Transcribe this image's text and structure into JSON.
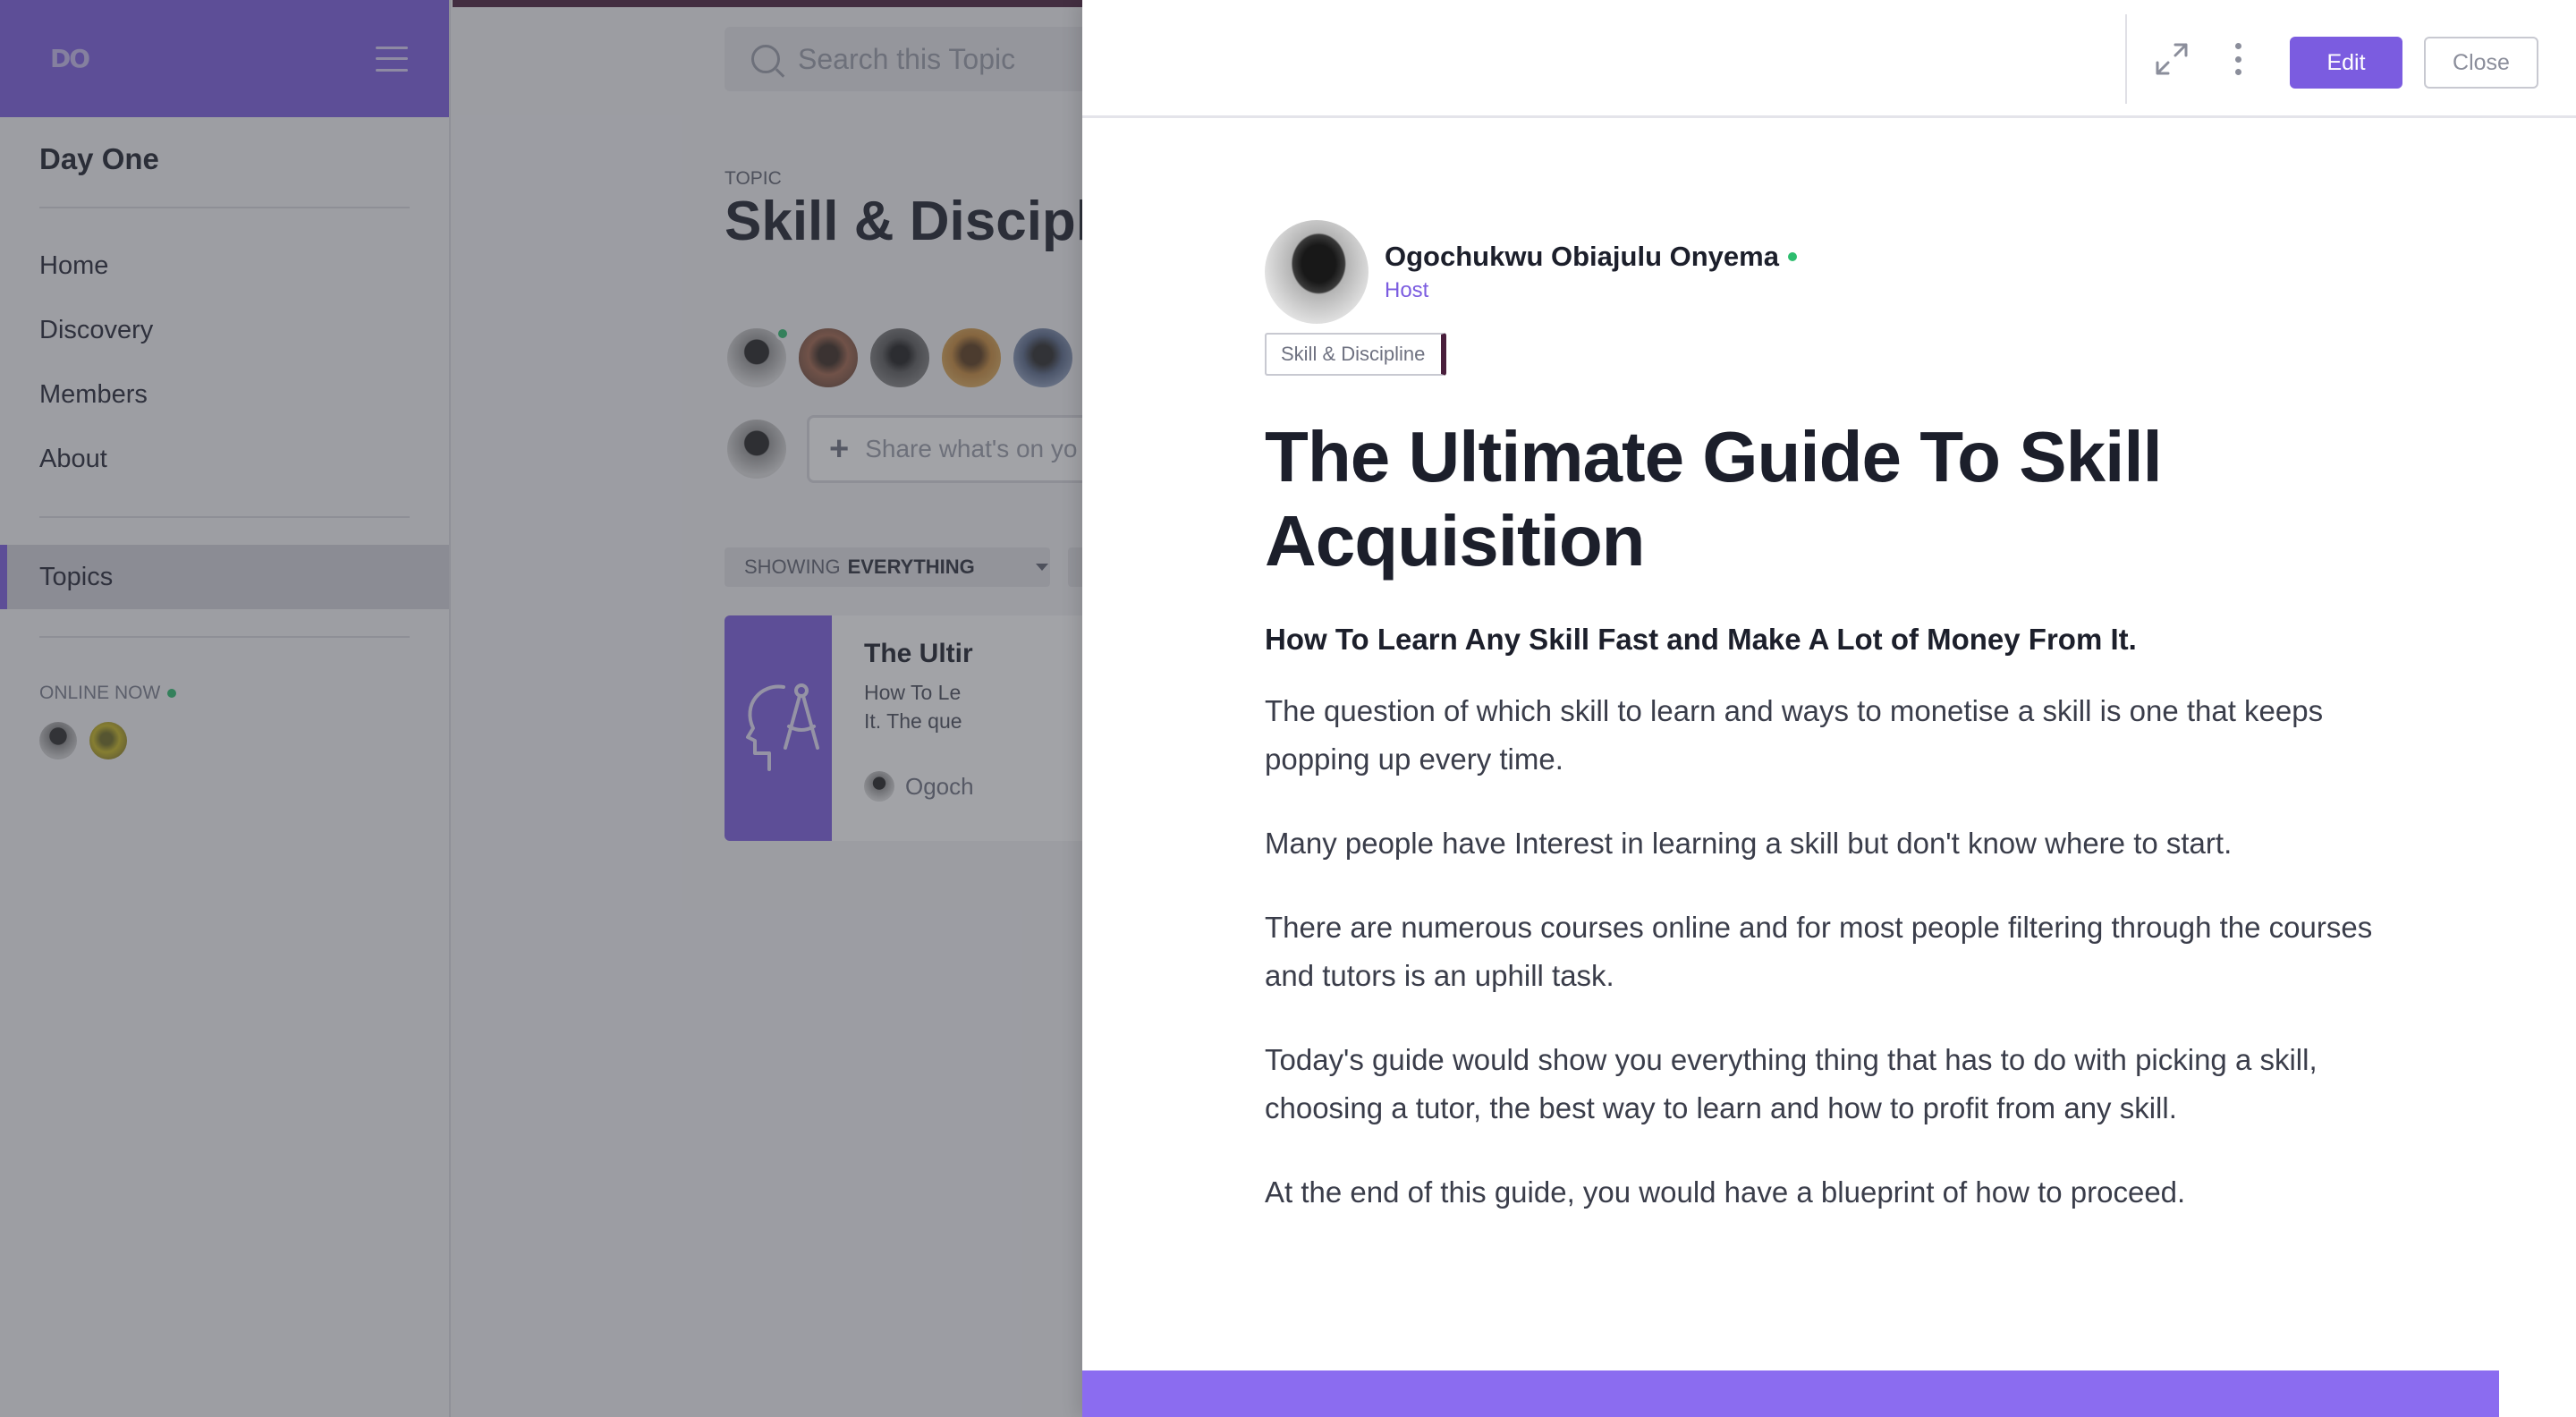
{
  "sidebar": {
    "logo": "DO",
    "space_name": "Day One",
    "nav": [
      "Home",
      "Discovery",
      "Members",
      "About"
    ],
    "topics_label": "Topics",
    "online_label": "ONLINE NOW"
  },
  "main": {
    "search_placeholder": "Search this Topic",
    "topic_label": "TOPIC",
    "topic_title": "Skill & Disciplin",
    "share_placeholder": "Share what's on yo",
    "filter_prefix": "SHOWING",
    "filter_value": "EVERYTHING",
    "post": {
      "title": "The Ultir",
      "excerpt_1": "How To Le",
      "excerpt_2": "It. The que",
      "author": "Ogoch"
    }
  },
  "panel": {
    "edit_label": "Edit",
    "close_label": "Close",
    "author_name": "Ogochukwu Obiajulu Onyema",
    "author_role": "Host",
    "tag": "Skill & Discipline",
    "title": "The Ultimate Guide To Skill Acquisition",
    "subtitle": "How To Learn Any Skill Fast and Make A Lot of Money From It.",
    "paragraphs": [
      "The question of which skill to learn and ways to monetise a skill is one that keeps popping up every time.",
      "Many people have Interest in learning a skill but don't know where to start.",
      "There are numerous courses online and for most people filtering through the courses and  tutors is an uphill task.",
      "Today's guide would show you everything thing that has to do with picking a skill, choosing a tutor, the best way to learn and how to profit from any skill.",
      "At the end of this guide, you would have a blueprint of how to proceed."
    ]
  },
  "colors": {
    "brand": "#7b5ce0",
    "online": "#2dbd6e",
    "accent_dark": "#4a1f3c"
  }
}
